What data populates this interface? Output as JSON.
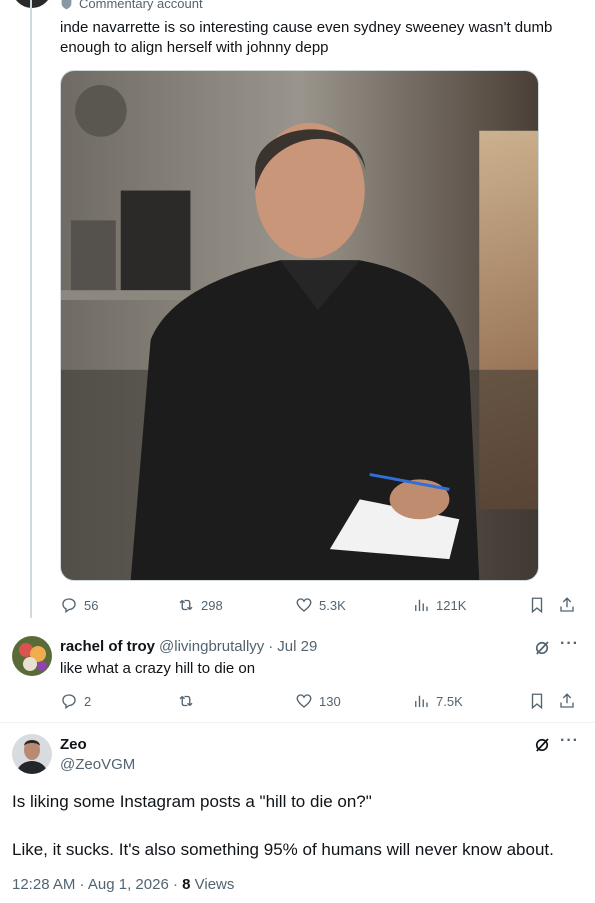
{
  "top_tweet": {
    "label": "Commentary account",
    "text": "inde navarrette is so interesting cause even sydney sweeney wasn't dumb enough to align herself with johnny depp",
    "actions": {
      "replies": "56",
      "retweets": "298",
      "likes": "5.3K",
      "views": "121K"
    }
  },
  "reply": {
    "name": "rachel of troy",
    "handle": "@livingbrutallyy",
    "dot": "·",
    "date": "Jul 29",
    "text": "like what a crazy hill to die on",
    "actions": {
      "replies": "2",
      "retweets": "",
      "likes": "130",
      "views": "7.5K"
    }
  },
  "main_tweet": {
    "name": "Zeo",
    "handle": "@ZeoVGM",
    "paragraph1": "Is liking some Instagram posts a \"hill to die on?\"",
    "paragraph2": "Like, it sucks. It's also something 95% of humans will never know about.",
    "time": "12:28 AM · Aug 1, 2026 · ",
    "views_count": "8",
    "views_label": " Views"
  },
  "icons": {
    "reply": "speech-bubble-icon",
    "retweet": "retweet-icon",
    "like": "heart-icon",
    "views": "bar-chart-icon",
    "bookmark": "bookmark-icon",
    "share": "share-icon",
    "grok": "grok-icon",
    "more": "more-dots-icon"
  },
  "colors": {
    "text": "#0f1419",
    "secondary": "#536471",
    "border": "#cfd9de"
  }
}
